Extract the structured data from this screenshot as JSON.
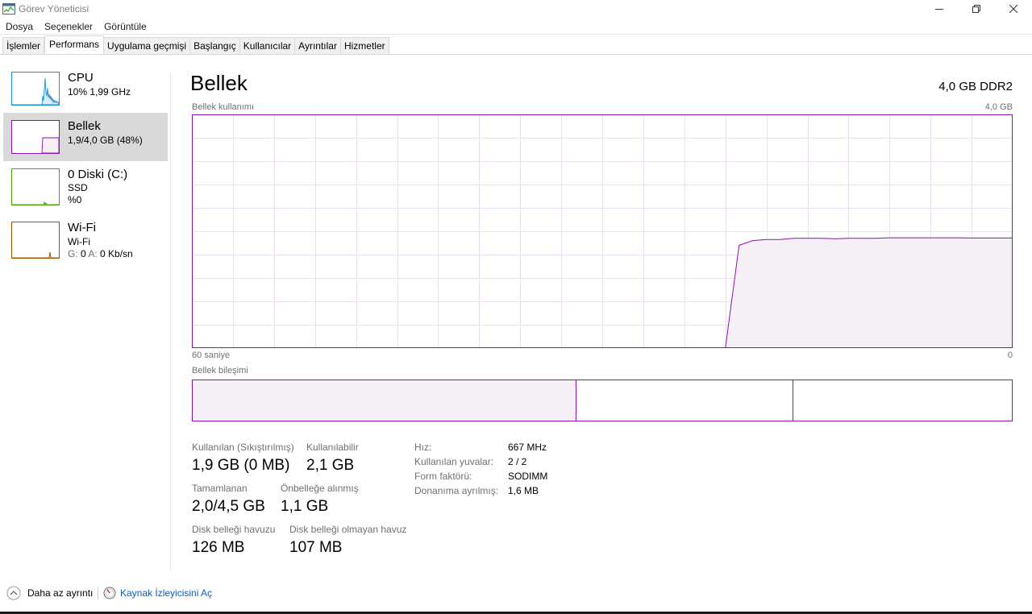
{
  "window": {
    "title": "Görev Yöneticisi",
    "controls": [
      "minimize-icon",
      "restore-icon",
      "close-icon"
    ]
  },
  "menu": [
    "Dosya",
    "Seçenekler",
    "Görüntüle"
  ],
  "tabs": [
    {
      "label": "İşlemler",
      "active": false
    },
    {
      "label": "Performans",
      "active": true
    },
    {
      "label": "Uygulama geçmişi",
      "active": false
    },
    {
      "label": "Başlangıç",
      "active": false
    },
    {
      "label": "Kullanıcılar",
      "active": false
    },
    {
      "label": "Ayrıntılar",
      "active": false
    },
    {
      "label": "Hizmetler",
      "active": false
    }
  ],
  "sidebar": {
    "items": [
      {
        "title": "CPU",
        "sub1": "10%  1,99 GHz",
        "sub2": "",
        "color": "#1a8fcf",
        "selected": false
      },
      {
        "title": "Bellek",
        "sub1": "1,9/4,0 GB (48%)",
        "sub2": "",
        "color": "#8b12ae",
        "selected": true
      },
      {
        "title": "0 Diski (C:)",
        "sub1": "SSD",
        "sub2": "%0",
        "color": "#4da60c",
        "selected": false
      },
      {
        "title": "Wi-Fi",
        "sub1": "Wi-Fi",
        "sub2_label": "G:",
        "sub2_value1": " 0 ",
        "sub2_label2": "A:",
        "sub2_value2": " 0 Kb/sn",
        "color": "#a74f01",
        "selected": false
      }
    ]
  },
  "main": {
    "title": "Bellek",
    "spec": "4,0 GB DDR2",
    "usage_label": "Bellek kullanımı",
    "usage_max": "4,0 GB",
    "time_left": "60 saniye",
    "time_right": "0",
    "composition_label": "Bellek bileşimi",
    "accent_color": "#8b12ae",
    "usage_series_fraction": [
      0,
      0,
      0,
      0,
      0,
      0,
      0,
      0,
      0,
      0,
      0,
      0,
      0,
      0,
      0,
      0,
      0,
      0,
      0,
      0,
      0,
      0,
      0,
      0,
      0,
      0,
      0,
      0,
      0,
      0,
      0,
      0,
      0,
      0,
      0,
      0,
      0,
      0,
      0,
      0,
      0.44,
      0.46,
      0.465,
      0.465,
      0.47,
      0.47,
      0.47,
      0.468,
      0.47,
      0.47,
      0.47,
      0.472,
      0.472,
      0.472,
      0.472,
      0.472,
      0.472,
      0.471,
      0.471,
      0.471,
      0.471
    ],
    "composition_fractions": {
      "in_use": 0.468,
      "modified": 0.0,
      "standby": 0.265,
      "free": 0.267
    }
  },
  "stats": {
    "in_use_label": "Kullanılan (Sıkıştırılmış)",
    "in_use_value": "1,9 GB (0 MB)",
    "available_label": "Kullanılabilir",
    "available_value": "2,1 GB",
    "committed_label": "Tamamlanan",
    "committed_value": "2,0/4,5 GB",
    "cached_label": "Önbelleğe alınmış",
    "cached_value": "1,1 GB",
    "paged_label": "Disk belleği havuzu",
    "paged_value": "126 MB",
    "nonpaged_label": "Disk belleği olmayan havuz",
    "nonpaged_value": "107 MB"
  },
  "details": {
    "speed_label": "Hız:",
    "speed_value": "667 MHz",
    "slots_label": "Kullanılan yuvalar:",
    "slots_value": "2 / 2",
    "form_label": "Form faktörü:",
    "form_value": "SODIMM",
    "reserved_label": "Donanıma ayrılmış:",
    "reserved_value": "1,6 MB"
  },
  "footer": {
    "fewer_details": "Daha az ayrıntı",
    "resource_monitor": "Kaynak İzleyicisini Aç"
  }
}
